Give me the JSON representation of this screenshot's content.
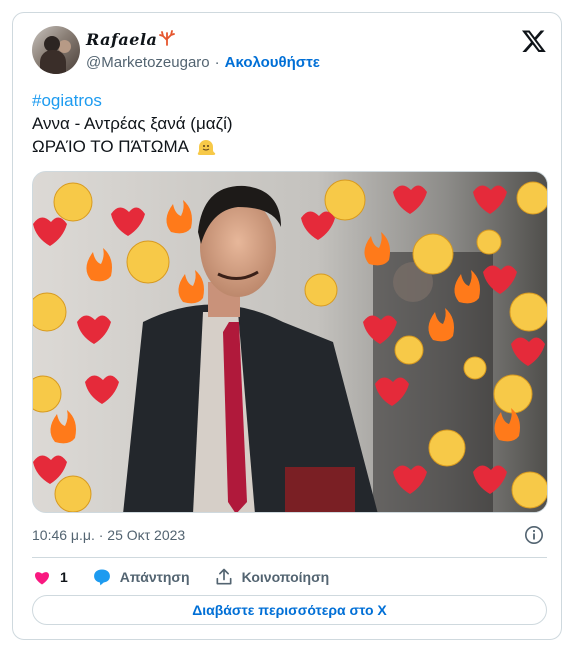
{
  "tweet": {
    "author": {
      "display_name": "Rafaela",
      "name_emoji": "coral-icon",
      "handle": "@Marketozeugaro",
      "separator": "·",
      "follow_label": "Ακολουθήστε"
    },
    "text": {
      "hashtag": "#ogiatros",
      "line2": "Αννα - Αντρέας ξανά (μαζί)",
      "line3": "ΩΡΑΊΟ ΤΟ ΠΆΤΩΜΑ",
      "line3_emoji": "melting-face-emoji"
    },
    "timestamp": "10:46 μ.μ. · 25 Οκτ 2023",
    "actions": {
      "likes_count": "1",
      "reply_label": "Απάντηση",
      "share_label": "Κοινοποίηση"
    },
    "read_more_label": "Διαβάστε περισσότερα στο X"
  },
  "colors": {
    "link": "#1d9bf0",
    "follow": "#006fd6",
    "heart": "#f91880",
    "muted": "#536471",
    "border": "#cfd9de"
  }
}
